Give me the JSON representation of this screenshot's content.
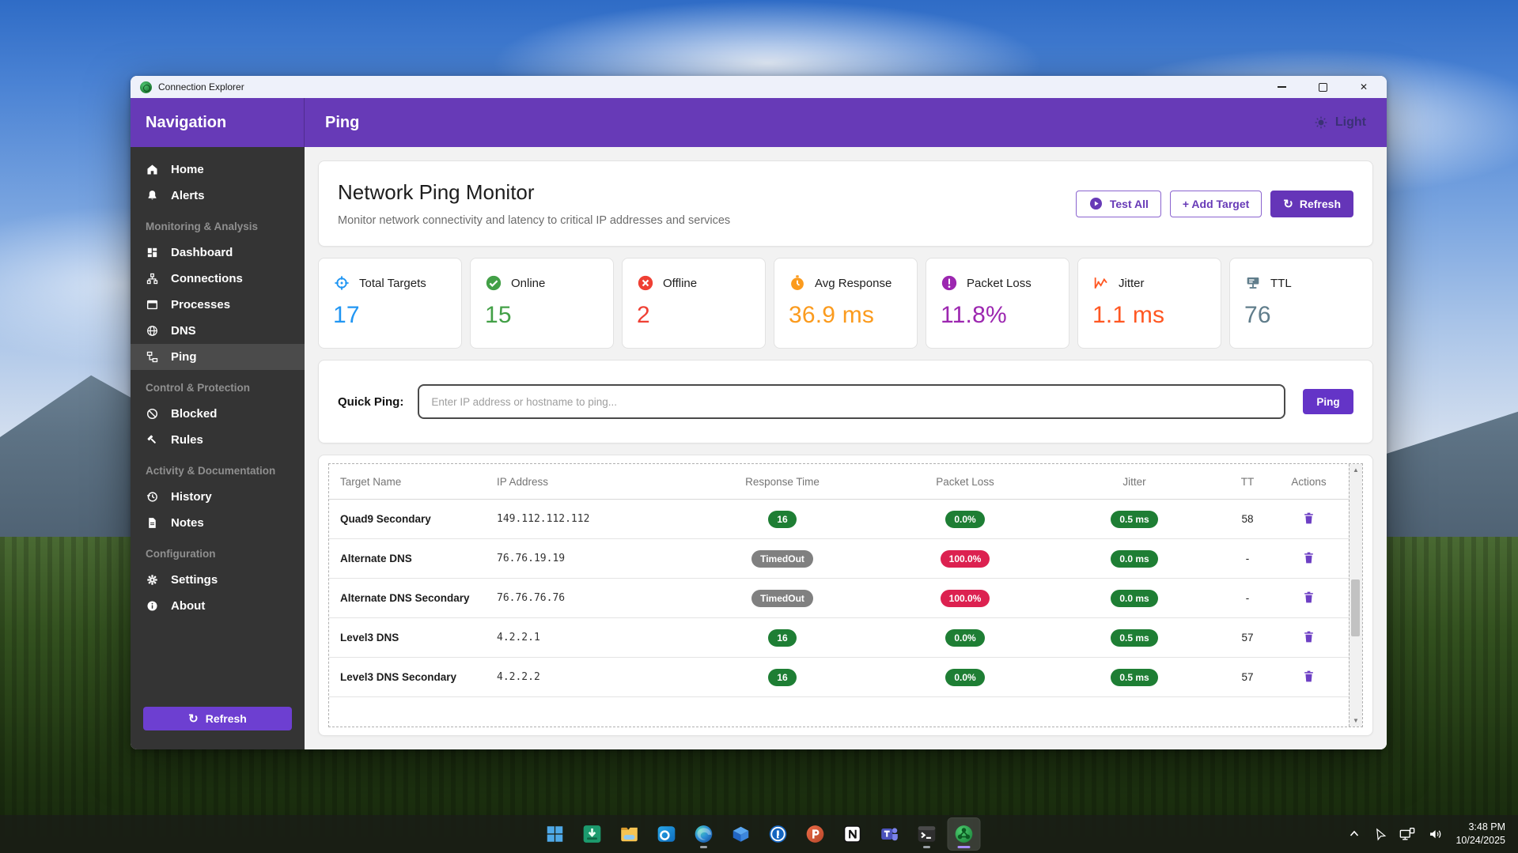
{
  "window": {
    "title": "Connection Explorer",
    "controls": [
      "minimize-icon",
      "maximize-icon",
      "close-icon"
    ]
  },
  "appbar": {
    "nav_title": "Navigation",
    "page_title": "Ping",
    "theme_toggle": "Light"
  },
  "sidebar": {
    "groups": [
      {
        "label": "",
        "items": [
          {
            "label": "Home",
            "icon": "home-icon"
          },
          {
            "label": "Alerts",
            "icon": "bell-icon"
          }
        ]
      },
      {
        "label": "Monitoring & Analysis",
        "items": [
          {
            "label": "Dashboard",
            "icon": "dashboard-icon"
          },
          {
            "label": "Connections",
            "icon": "network-icon"
          },
          {
            "label": "Processes",
            "icon": "window-icon"
          },
          {
            "label": "DNS",
            "icon": "globe-icon"
          },
          {
            "label": "Ping",
            "icon": "ping-icon",
            "active": true
          }
        ]
      },
      {
        "label": "Control & Protection",
        "items": [
          {
            "label": "Blocked",
            "icon": "block-icon"
          },
          {
            "label": "Rules",
            "icon": "gavel-icon"
          }
        ]
      },
      {
        "label": "Activity & Documentation",
        "items": [
          {
            "label": "History",
            "icon": "history-icon"
          },
          {
            "label": "Notes",
            "icon": "note-icon"
          }
        ]
      },
      {
        "label": "Configuration",
        "items": [
          {
            "label": "Settings",
            "icon": "gear-icon"
          },
          {
            "label": "About",
            "icon": "info-icon"
          }
        ]
      }
    ],
    "refresh_label": "Refresh"
  },
  "main": {
    "hero": {
      "title": "Network Ping Monitor",
      "subtitle": "Monitor network connectivity and latency to critical IP addresses and services",
      "test_all": "Test All",
      "add_target": "+  Add Target",
      "refresh": "Refresh"
    },
    "stats": [
      {
        "label": "Total Targets",
        "value": "17",
        "color": "#2196f3",
        "icon": "target-icon"
      },
      {
        "label": "Online",
        "value": "15",
        "color": "#43a047",
        "icon": "check-circle-icon"
      },
      {
        "label": "Offline",
        "value": "2",
        "color": "#ef4034",
        "icon": "x-circle-icon"
      },
      {
        "label": "Avg Response",
        "value": "36.9 ms",
        "color": "#fb9b1e",
        "icon": "stopwatch-icon"
      },
      {
        "label": "Packet Loss",
        "value": "11.8%",
        "color": "#9c27b0",
        "icon": "alert-circle-icon"
      },
      {
        "label": "Jitter",
        "value": "1.1 ms",
        "color": "#ff5722",
        "icon": "line-chart-icon"
      },
      {
        "label": "TTL",
        "value": "76",
        "color": "#607d8b",
        "icon": "server-icon"
      }
    ],
    "quick_ping": {
      "label": "Quick Ping:",
      "placeholder": "Enter IP address or hostname to ping...",
      "value": "",
      "button": "Ping"
    },
    "table": {
      "columns": [
        "Target Name",
        "IP Address",
        "Response Time",
        "Packet Loss",
        "Jitter",
        "TT",
        "Actions"
      ],
      "rows": [
        {
          "name": "Quad9 Secondary",
          "ip": "149.112.112.112",
          "response": "16",
          "response_tone": "green",
          "loss": "0.0%",
          "loss_tone": "green",
          "jitter": "0.5 ms",
          "jitter_tone": "green",
          "ttl": "58"
        },
        {
          "name": "Alternate DNS",
          "ip": "76.76.19.19",
          "response": "TimedOut",
          "response_tone": "gray",
          "loss": "100.0%",
          "loss_tone": "red",
          "jitter": "0.0 ms",
          "jitter_tone": "green",
          "ttl": "-"
        },
        {
          "name": "Alternate DNS Secondary",
          "ip": "76.76.76.76",
          "response": "TimedOut",
          "response_tone": "gray",
          "loss": "100.0%",
          "loss_tone": "red",
          "jitter": "0.0 ms",
          "jitter_tone": "green",
          "ttl": "-"
        },
        {
          "name": "Level3 DNS",
          "ip": "4.2.2.1",
          "response": "16",
          "response_tone": "green",
          "loss": "0.0%",
          "loss_tone": "green",
          "jitter": "0.5 ms",
          "jitter_tone": "green",
          "ttl": "57"
        },
        {
          "name": "Level3 DNS Secondary",
          "ip": "4.2.2.2",
          "response": "16",
          "response_tone": "green",
          "loss": "0.0%",
          "loss_tone": "green",
          "jitter": "0.5 ms",
          "jitter_tone": "green",
          "ttl": "57"
        }
      ]
    }
  },
  "taskbar": {
    "icons": [
      {
        "name": "start",
        "indicator": "none"
      },
      {
        "name": "software-center",
        "indicator": "none"
      },
      {
        "name": "file-explorer",
        "indicator": "none"
      },
      {
        "name": "outlook",
        "indicator": "none"
      },
      {
        "name": "edge",
        "indicator": "open"
      },
      {
        "name": "box-drive",
        "indicator": "none"
      },
      {
        "name": "onepassword",
        "indicator": "none"
      },
      {
        "name": "powerpoint",
        "indicator": "none"
      },
      {
        "name": "notion",
        "indicator": "none"
      },
      {
        "name": "teams",
        "indicator": "none"
      },
      {
        "name": "terminal",
        "indicator": "open"
      },
      {
        "name": "connection-explorer",
        "indicator": "active"
      }
    ],
    "tray": {
      "icons": [
        "chevron-up-icon",
        "location-icon",
        "network-display-icon",
        "volume-icon"
      ],
      "time": "3:48 PM",
      "date": "10/24/2025"
    }
  },
  "colors": {
    "accent": "#673ab7",
    "accent_button": "#6d3fd1",
    "badge_green": "#1e7e34",
    "badge_gray": "#808080",
    "badge_red": "#dc2150"
  }
}
